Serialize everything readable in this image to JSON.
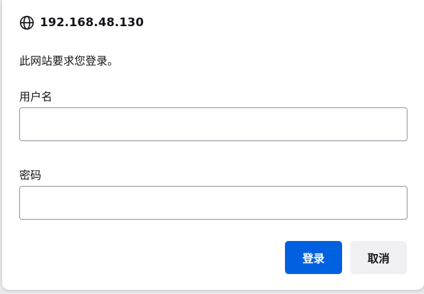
{
  "dialog": {
    "host": "192.168.48.130",
    "message": "此网站要求您登录。",
    "username_label": "用户名",
    "username_value": "",
    "password_label": "密码",
    "password_value": "",
    "login_button": "登录",
    "cancel_button": "取消",
    "globe_icon": "globe-icon"
  },
  "colors": {
    "primary": "#0061e0",
    "secondary": "#f0f0f4",
    "text": "#15141a",
    "border": "#8f8f9d"
  }
}
